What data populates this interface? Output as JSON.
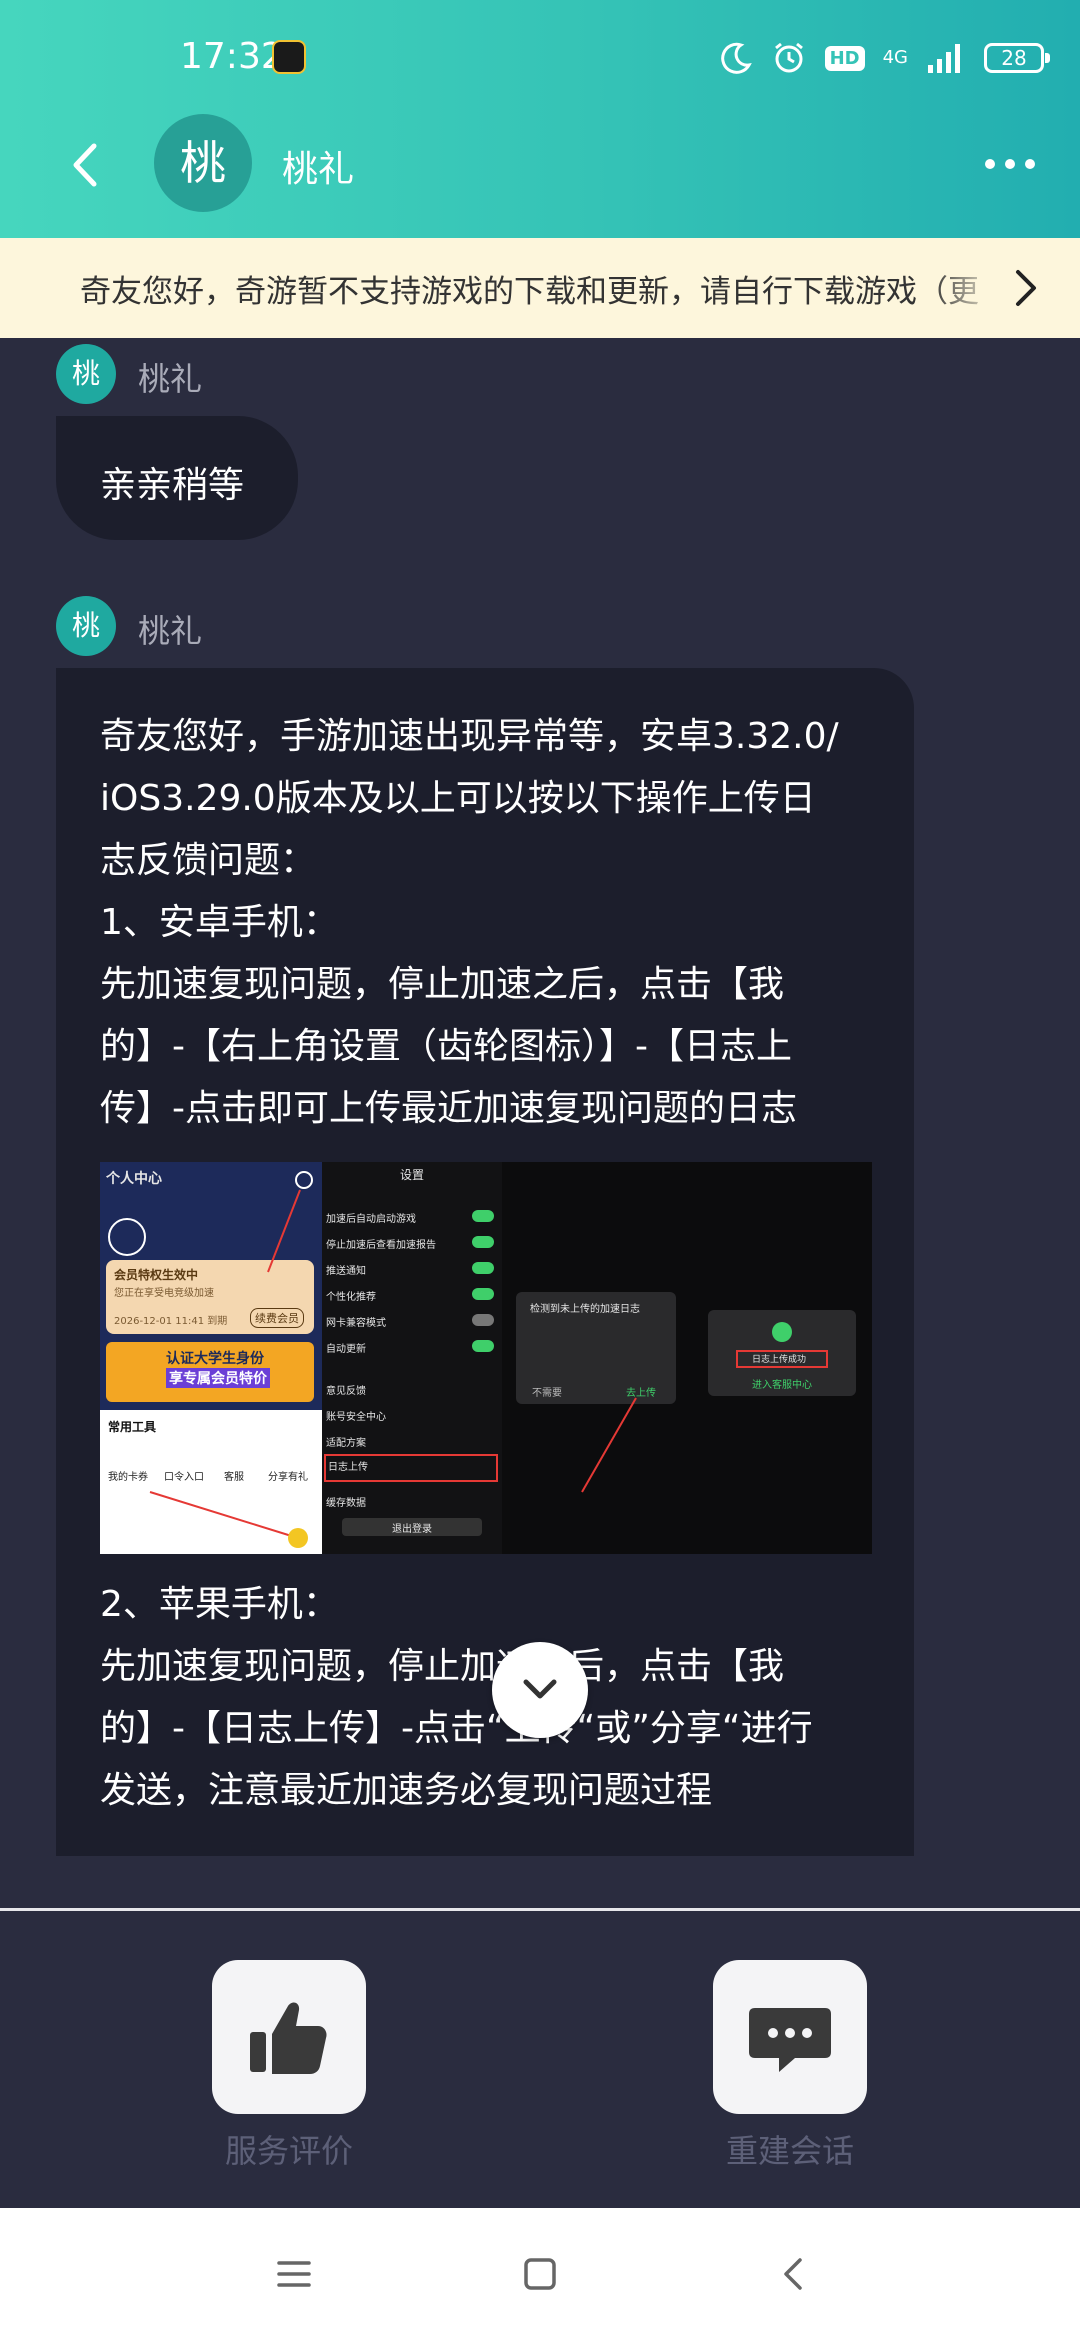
{
  "status_bar": {
    "time": "17:32",
    "hd": "HD",
    "network": "4G",
    "battery": "28"
  },
  "header": {
    "avatar_char": "桃",
    "agent_name": "桃礼"
  },
  "notice": {
    "text": "奇友您好，奇游暂不支持游戏的下载和更新，请自行下载游戏（更"
  },
  "messages": [
    {
      "sender_avatar_char": "桃",
      "sender": "桃礼",
      "text": "亲亲稍等"
    },
    {
      "sender_avatar_char": "桃",
      "sender": "桃礼",
      "part1_lines": [
        "奇友您好，手游加速出现异常等，安卓3.32.0/",
        "iOS3.29.0版本及以上可以按以下操作上传日",
        "志反馈问题：",
        "1、安卓手机：",
        "先加速复现问题，停止加速之后，点击【我",
        "的】-【右上角设置（齿轮图标）】-【日志上",
        "传】-点击即可上传最近加速复现问题的日志"
      ],
      "part2_lines": [
        "2、苹果手机：",
        "先加速复现问题，停止加速之后，点击【我",
        "的】-【日志上传】-点击“上传“或”分享“进行",
        "发送，注意最近加速务必复现问题过程"
      ]
    }
  ],
  "screenshot_labels": {
    "p1_title": "个人中心",
    "p1_vip": "会员特权生效中",
    "p1_vip_sub": "您正在享受电竞级加速",
    "p1_date": "2026-12-01 11:41 到期",
    "p1_renew": "续费会员",
    "p1_banner": "认证大学生身份",
    "p1_banner2": "享专属会员特价",
    "p1_tools": "常用工具",
    "p1_tool1": "我的卡券",
    "p1_tool2": "口令入口",
    "p1_tool3": "客服",
    "p1_tool4": "分享有礼",
    "p2_title": "设置",
    "p2_row1": "加速后自动启动游戏",
    "p2_row2": "停止加速后查看加速报告",
    "p2_row3": "推送通知",
    "p2_row4": "个性化推荐",
    "p2_row5": "网卡兼容模式",
    "p2_row6": "自动更新",
    "p2_row7": "意见反馈",
    "p2_row8": "账号安全中心",
    "p2_row9": "适配方案",
    "p2_row10": "日志上传",
    "p2_row11": "缓存数据",
    "p2_logout": "退出登录",
    "p3_dialog_title": "检测到未上传的加速日志",
    "p3_cancel": "不需要",
    "p3_confirm": "去上传",
    "p4_btn": "日志上传成功",
    "p4_link": "进入客服中心"
  },
  "actions": {
    "rate_label": "服务评价",
    "rebuild_label": "重建会话"
  }
}
